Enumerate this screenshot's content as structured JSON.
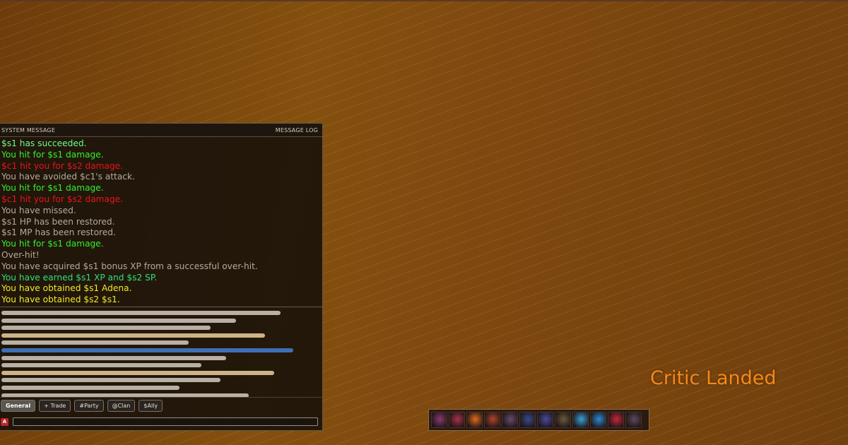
{
  "chat": {
    "title": "SYSTEM MESSAGE",
    "log_label": "MESSAGE LOG",
    "messages": [
      {
        "text": "$s1 has succeeded.",
        "color": "#6dfc8c"
      },
      {
        "text": "You hit for $s1 damage.",
        "color": "#32f02f"
      },
      {
        "text": "$c1 hit you for $s2 damage.",
        "color": "#e8141c"
      },
      {
        "text": "You have avoided $c1's attack.",
        "color": "#b3aa9c"
      },
      {
        "text": "You hit for $s1 damage.",
        "color": "#32f02f"
      },
      {
        "text": "$c1 hit you for $s2 damage.",
        "color": "#e8141c"
      },
      {
        "text": "You have missed.",
        "color": "#b3aa9c"
      },
      {
        "text": "$s1 HP has been restored.",
        "color": "#b3aa9c"
      },
      {
        "text": "$s1 MP has been restored.",
        "color": "#b3aa9c"
      },
      {
        "text": "You hit for $s1 damage.",
        "color": "#32f02f"
      },
      {
        "text": "Over-hit!",
        "color": "#b3aa9c"
      },
      {
        "text": "You have acquired $s1 bonus XP from a successful over-hit.",
        "color": "#b3aa9c"
      },
      {
        "text": "You have earned $s1 XP and $s2 SP.",
        "color": "#2ee07a"
      },
      {
        "text": "You have obtained $s1 Adena.",
        "color": "#f0ea28"
      },
      {
        "text": "You have obtained $s2 $s1.",
        "color": "#f0ea28"
      }
    ],
    "tabs": [
      {
        "label": "General",
        "active": true
      },
      {
        "label": "+ Trade",
        "active": false
      },
      {
        "label": "#Party",
        "active": false
      },
      {
        "label": "@Clan",
        "active": false
      },
      {
        "label": "$Ally",
        "active": false
      }
    ],
    "channel_button": "A",
    "input_value": ""
  },
  "floating_text": {
    "text": "Critic Landed",
    "color": "#f28a1a"
  },
  "buffs": [
    {
      "icon": "buff-icon-1",
      "color": "#8a3a6e"
    },
    {
      "icon": "buff-icon-2",
      "color": "#a8324a"
    },
    {
      "icon": "buff-icon-3",
      "color": "#e06a1c"
    },
    {
      "icon": "buff-icon-4",
      "color": "#b0442c"
    },
    {
      "icon": "buff-icon-5",
      "color": "#6a4a6a"
    },
    {
      "icon": "buff-icon-6",
      "color": "#3a4a8a"
    },
    {
      "icon": "buff-icon-7",
      "color": "#4a4a9a"
    },
    {
      "icon": "buff-icon-8",
      "color": "#6a5a3a"
    },
    {
      "icon": "buff-icon-9",
      "color": "#3aa0d8"
    },
    {
      "icon": "buff-icon-10",
      "color": "#2c8ad0"
    },
    {
      "icon": "buff-icon-11",
      "color": "#c02a3a"
    },
    {
      "icon": "buff-icon-12",
      "color": "#5a4a5a"
    }
  ]
}
